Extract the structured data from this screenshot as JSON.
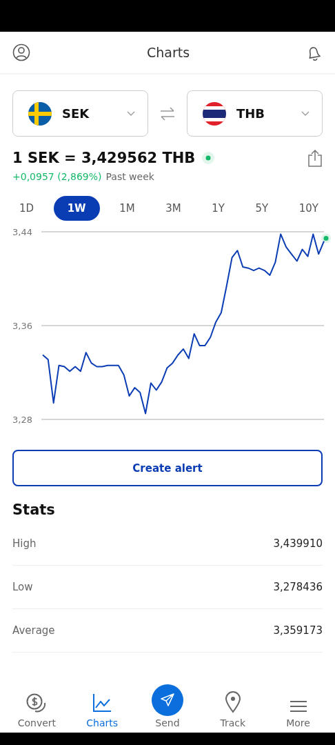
{
  "header": {
    "title": "Charts"
  },
  "currencies": [
    {
      "code": "SEK"
    },
    {
      "code": "THB"
    }
  ],
  "rate": {
    "text": "1 SEK = 3,429562 THB",
    "change": "+0,0957 (2,869%)",
    "period": "Past week"
  },
  "ranges": [
    {
      "label": "1D",
      "selected": false
    },
    {
      "label": "1W",
      "selected": true
    },
    {
      "label": "1M",
      "selected": false
    },
    {
      "label": "3M",
      "selected": false
    },
    {
      "label": "1Y",
      "selected": false
    },
    {
      "label": "5Y",
      "selected": false
    },
    {
      "label": "10Y",
      "selected": false
    }
  ],
  "chart": {
    "chart_data": {
      "type": "line",
      "ylim": [
        3.28,
        3.44
      ],
      "yticks": [
        {
          "value": 3.28,
          "label": "3,28"
        },
        {
          "value": 3.36,
          "label": "3,36"
        },
        {
          "value": 3.44,
          "label": "3,44"
        }
      ],
      "series": [
        {
          "color": "#0a3cb4",
          "values": [
            3.335,
            3.331,
            3.294,
            3.326,
            3.325,
            3.321,
            3.325,
            3.321,
            3.337,
            3.328,
            3.325,
            3.325,
            3.326,
            3.326,
            3.326,
            3.318,
            3.3,
            3.307,
            3.303,
            3.285,
            3.311,
            3.305,
            3.312,
            3.324,
            3.328,
            3.335,
            3.34,
            3.332,
            3.353,
            3.343,
            3.343,
            3.35,
            3.363,
            3.371,
            3.394,
            3.418,
            3.424,
            3.41,
            3.409,
            3.407,
            3.409,
            3.407,
            3.403,
            3.414,
            3.438,
            3.427,
            3.421,
            3.415,
            3.425,
            3.419,
            3.438,
            3.421,
            3.432
          ]
        }
      ]
    }
  },
  "create_alert": "Create alert",
  "stats": {
    "title": "Stats",
    "rows": [
      {
        "label": "High",
        "value": "3,439910"
      },
      {
        "label": "Low",
        "value": "3,278436"
      },
      {
        "label": "Average",
        "value": "3,359173"
      }
    ]
  },
  "nav": [
    {
      "label": "Convert",
      "kind": "tab",
      "selected": false
    },
    {
      "label": "Charts",
      "kind": "tab",
      "selected": true
    },
    {
      "label": "Send",
      "kind": "action",
      "selected": false
    },
    {
      "label": "Track",
      "kind": "tab",
      "selected": false
    },
    {
      "label": "More",
      "kind": "tab",
      "selected": false
    }
  ]
}
